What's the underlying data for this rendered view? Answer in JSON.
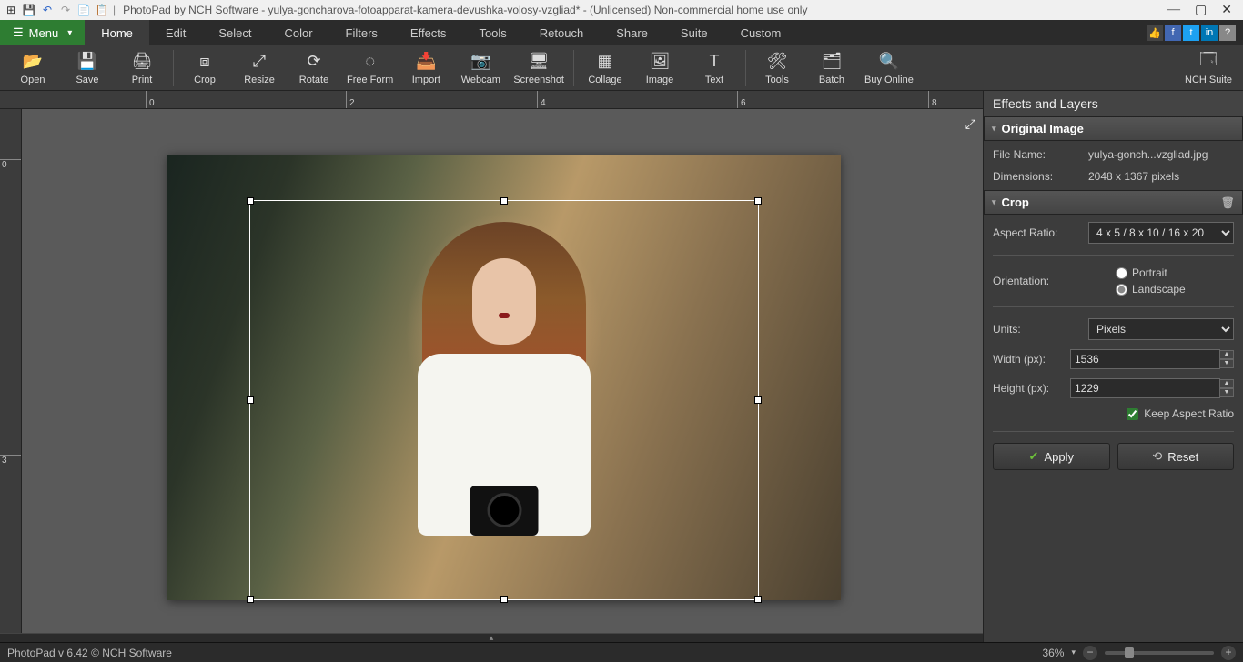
{
  "app": {
    "title": "PhotoPad by NCH Software - yulya-goncharova-fotoapparat-kamera-devushka-volosy-vzgliad* - (Unlicensed) Non-commercial home use only"
  },
  "menu_button": "Menu",
  "menubar": [
    "Home",
    "Edit",
    "Select",
    "Color",
    "Filters",
    "Effects",
    "Tools",
    "Retouch",
    "Share",
    "Suite",
    "Custom"
  ],
  "active_tab": "Home",
  "toolbar": [
    {
      "label": "Open",
      "icon": "📂",
      "sep": false
    },
    {
      "label": "Save",
      "icon": "💾",
      "sep": false
    },
    {
      "label": "Print",
      "icon": "🖨",
      "sep": true
    },
    {
      "label": "Crop",
      "icon": "⧈",
      "sep": false
    },
    {
      "label": "Resize",
      "icon": "⤢",
      "sep": false
    },
    {
      "label": "Rotate",
      "icon": "⟳",
      "sep": false
    },
    {
      "label": "Free Form",
      "icon": "◌",
      "sep": false
    },
    {
      "label": "Import",
      "icon": "📥",
      "sep": false
    },
    {
      "label": "Webcam",
      "icon": "📷",
      "sep": false
    },
    {
      "label": "Screenshot",
      "icon": "🖥",
      "sep": true
    },
    {
      "label": "Collage",
      "icon": "▦",
      "sep": false
    },
    {
      "label": "Image",
      "icon": "🖼",
      "sep": false
    },
    {
      "label": "Text",
      "icon": "T",
      "sep": true
    },
    {
      "label": "Tools",
      "icon": "🛠",
      "sep": false
    },
    {
      "label": "Batch",
      "icon": "🗂",
      "sep": false
    },
    {
      "label": "Buy Online",
      "icon": "🔍",
      "sep": false
    }
  ],
  "toolbar_right": {
    "label": "NCH Suite",
    "icon": "🗔"
  },
  "ruler_h": [
    "0",
    "2",
    "4",
    "6",
    "8"
  ],
  "ruler_v": [
    "0",
    "3"
  ],
  "panel": {
    "title": "Effects and Layers",
    "original": {
      "header": "Original Image",
      "filename_label": "File Name:",
      "filename": "yulya-gonch...vzgliad.jpg",
      "dimensions_label": "Dimensions:",
      "dimensions": "2048 x 1367 pixels"
    },
    "crop": {
      "header": "Crop",
      "aspect_label": "Aspect Ratio:",
      "aspect_value": "4 x 5 / 8 x 10 / 16 x 20",
      "orientation_label": "Orientation:",
      "orientation_portrait": "Portrait",
      "orientation_landscape": "Landscape",
      "orientation_selected": "Landscape",
      "units_label": "Units:",
      "units_value": "Pixels",
      "width_label": "Width (px):",
      "width_value": "1536",
      "height_label": "Height (px):",
      "height_value": "1229",
      "keep_aspect": "Keep Aspect Ratio",
      "apply": "Apply",
      "reset": "Reset"
    }
  },
  "status": {
    "left": "PhotoPad v 6.42 © NCH Software",
    "zoom": "36%"
  }
}
